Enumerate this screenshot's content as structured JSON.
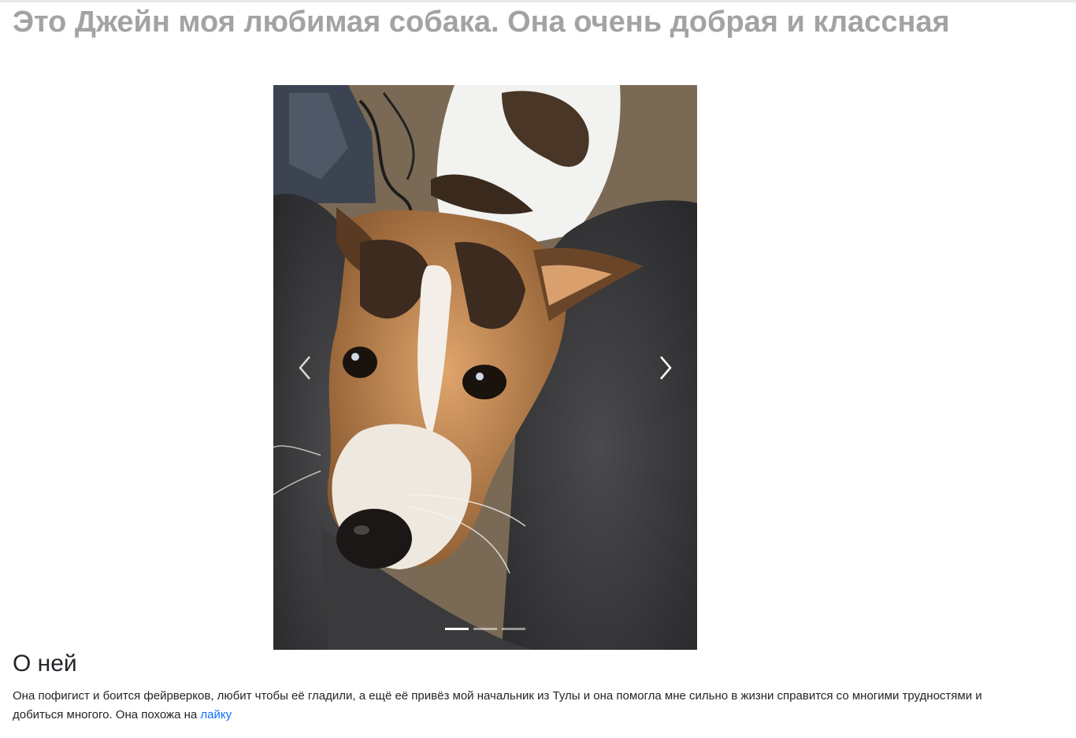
{
  "page": {
    "title": "Это Джейн моя любимая собака. Она очень добрая и классная"
  },
  "carousel": {
    "slides": [
      {
        "photo_icon": "dog-photo"
      },
      {
        "photo_icon": "dog-photo"
      },
      {
        "photo_icon": "dog-photo"
      }
    ],
    "active_index": 0,
    "prev_icon": "chevron-left-icon",
    "next_icon": "chevron-right-icon"
  },
  "about": {
    "heading": "О ней",
    "text": "Она пофигист и боится фейрверков, любит чтобы её гладили, а ещё её привёз мой начальник из Тулы и она помогла мне сильно в жизни справится со многими трудностями и добиться многого. Она похожа на ",
    "link_text": "лайку"
  },
  "colors": {
    "title": "#a3a3a3",
    "text": "#212529",
    "link": "#0d6efd"
  }
}
